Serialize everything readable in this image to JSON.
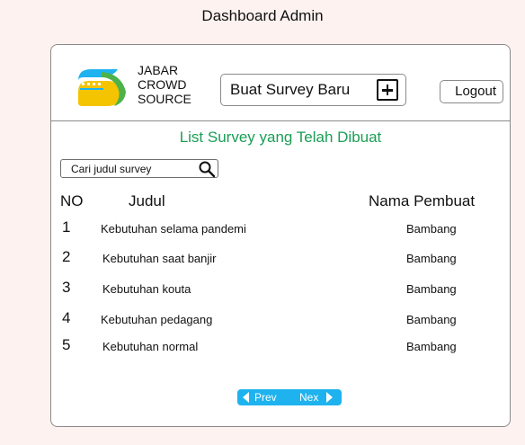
{
  "page_title": "Dashboard Admin",
  "brand": {
    "line1": "JABAR",
    "line2": "CROWD",
    "line3": "SOURCE"
  },
  "header": {
    "create_label": "Buat Survey Baru",
    "logout_label": "Logout"
  },
  "list_title": "List Survey yang Telah Dibuat",
  "search": {
    "placeholder": "Cari judul survey"
  },
  "table": {
    "headers": {
      "no": "NO",
      "title": "Judul",
      "creator": "Nama Pembuat"
    },
    "rows": [
      {
        "no": "1",
        "title": "Kebutuhan selama pandemi",
        "creator": "Bambang"
      },
      {
        "no": "2",
        "title": "Kebutuhan saat banjir",
        "creator": "Bambang"
      },
      {
        "no": "3",
        "title": "Kebutuhan kouta",
        "creator": "Bambang"
      },
      {
        "no": "4",
        "title": "Kebutuhan pedagang",
        "creator": "Bambang"
      },
      {
        "no": "5",
        "title": "Kebutuhan normal",
        "creator": "Bambang"
      }
    ]
  },
  "pagination": {
    "prev_label": "Prev",
    "next_label": "Nex"
  },
  "colors": {
    "accent_green": "#1a9e55",
    "pager_blue": "#1eb3ee",
    "logo_blue": "#1eb3ee",
    "logo_yellow": "#f5c400",
    "logo_green": "#4db24a",
    "background": "#fdf2f0"
  },
  "icons": {
    "search": "search-icon",
    "plus": "plus-icon",
    "logo": "jabar-logo-icon"
  }
}
